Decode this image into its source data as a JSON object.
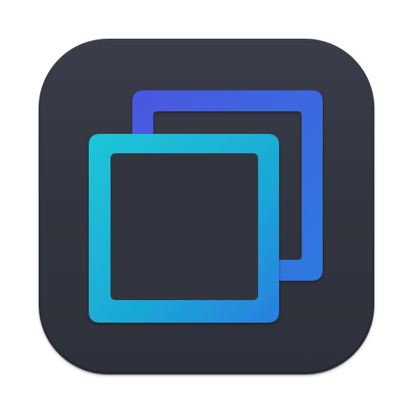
{
  "app_icon": {
    "icon_name": "copy-windows-icon",
    "colors": {
      "tile": "#32353f",
      "back_square_start": "#4a57e0",
      "back_square_end": "#2c7be0",
      "front_square_start": "#1ec6d8",
      "front_square_end": "#2a7fe0"
    }
  }
}
